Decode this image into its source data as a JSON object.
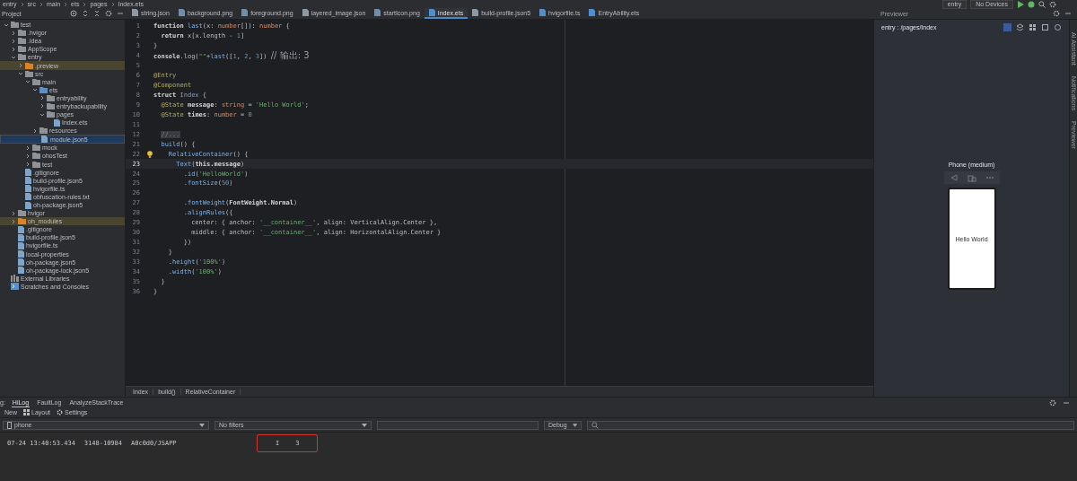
{
  "top_bar": {
    "breadcrumb": [
      "entry",
      "src",
      "main",
      "ets",
      "pages",
      "Index.ets"
    ],
    "run_config": "entry",
    "device": "No Devices"
  },
  "project_panel": {
    "title": "Project",
    "tree": [
      {
        "label": "test",
        "kind": "module",
        "expanded": true,
        "children": [
          {
            "label": ".hvigor",
            "kind": "folder",
            "expanded": false
          },
          {
            "label": ".idea",
            "kind": "folder",
            "expanded": false
          },
          {
            "label": "AppScope",
            "kind": "folder",
            "expanded": false
          },
          {
            "label": "entry",
            "kind": "module",
            "expanded": true,
            "children": [
              {
                "label": ".preview",
                "kind": "folder",
                "expanded": false,
                "excluded": true
              },
              {
                "label": "src",
                "kind": "folder",
                "expanded": true,
                "children": [
                  {
                    "label": "main",
                    "kind": "folder",
                    "expanded": true,
                    "children": [
                      {
                        "label": "ets",
                        "kind": "source",
                        "expanded": true,
                        "children": [
                          {
                            "label": "entryability",
                            "kind": "folder",
                            "expanded": false
                          },
                          {
                            "label": "entrybackupability",
                            "kind": "folder",
                            "expanded": false
                          },
                          {
                            "label": "pages",
                            "kind": "folder",
                            "expanded": true,
                            "children": [
                              {
                                "label": "Index.ets",
                                "kind": "file",
                                "selected": false
                              }
                            ]
                          }
                        ]
                      },
                      {
                        "label": "resources",
                        "kind": "folder",
                        "expanded": false
                      },
                      {
                        "label": "module.json5",
                        "kind": "file",
                        "selected": true
                      }
                    ]
                  },
                  {
                    "label": "mock",
                    "kind": "folder",
                    "expanded": false
                  },
                  {
                    "label": "ohosTest",
                    "kind": "folder",
                    "expanded": false
                  },
                  {
                    "label": "test",
                    "kind": "folder",
                    "expanded": false
                  }
                ]
              },
              {
                "label": ".gitignore",
                "kind": "file",
                "selected": false
              },
              {
                "label": "build-profile.json5",
                "kind": "file",
                "selected": false
              },
              {
                "label": "hvigorfile.ts",
                "kind": "file",
                "selected": false
              },
              {
                "label": "obfuscation-rules.txt",
                "kind": "file",
                "selected": false
              },
              {
                "label": "oh-package.json5",
                "kind": "file",
                "selected": false
              }
            ]
          },
          {
            "label": "hvigor",
            "kind": "folder",
            "expanded": false
          },
          {
            "label": "oh_modules",
            "kind": "folder",
            "expanded": false,
            "excluded": true
          },
          {
            "label": ".gitignore",
            "kind": "file",
            "selected": false
          },
          {
            "label": "build-profile.json5",
            "kind": "file",
            "selected": false
          },
          {
            "label": "hvigorfile.ts",
            "kind": "file",
            "selected": false
          },
          {
            "label": "local-properties",
            "kind": "file",
            "selected": false
          },
          {
            "label": "oh-package.json5",
            "kind": "file",
            "selected": false
          },
          {
            "label": "oh-package-lock.json5",
            "kind": "file",
            "selected": false
          }
        ]
      },
      {
        "label": "External Libraries",
        "kind": "library"
      },
      {
        "label": "Scratches and Consoles",
        "kind": "scratch"
      }
    ]
  },
  "editor_tabs": [
    {
      "label": "string.json",
      "kind": "json",
      "selected": false
    },
    {
      "label": "background.png",
      "kind": "image",
      "selected": false
    },
    {
      "label": "foreground.png",
      "kind": "image",
      "selected": false
    },
    {
      "label": "layered_image.json",
      "kind": "json",
      "selected": false
    },
    {
      "label": "startIcon.png",
      "kind": "image",
      "selected": false
    },
    {
      "label": "Index.ets",
      "kind": "code",
      "selected": true
    },
    {
      "label": "build-profile.json5",
      "kind": "json",
      "selected": false
    },
    {
      "label": "hvigorfile.ts",
      "kind": "code",
      "selected": false
    },
    {
      "label": "EntryAbility.ets",
      "kind": "code",
      "selected": false
    }
  ],
  "editor": {
    "lines": [
      {
        "number": "1",
        "tokens": [
          {
            "kind": "kw",
            "text": "function "
          },
          {
            "kind": "fn",
            "text": "last"
          },
          {
            "kind": "plain",
            "text": "(x: "
          },
          {
            "kind": "type",
            "text": "number"
          },
          {
            "kind": "plain",
            "text": "[]): "
          },
          {
            "kind": "type",
            "text": "number"
          },
          {
            "kind": "plain",
            "text": " {"
          }
        ]
      },
      {
        "number": "2",
        "tokens": [
          {
            "kind": "kw",
            "text": "  return "
          },
          {
            "kind": "plain",
            "text": "x[x.length - "
          },
          {
            "kind": "num",
            "text": "1"
          },
          {
            "kind": "plain",
            "text": "]"
          }
        ]
      },
      {
        "number": "3",
        "tokens": [
          {
            "kind": "plain",
            "text": "}"
          }
        ]
      },
      {
        "number": "4",
        "tokens": [
          {
            "kind": "kw",
            "text": "console"
          },
          {
            "kind": "plain",
            "text": ".log("
          },
          {
            "kind": "str",
            "text": "\"\""
          },
          {
            "kind": "plain",
            "text": "+"
          },
          {
            "kind": "fn",
            "text": "last"
          },
          {
            "kind": "plain",
            "text": "(["
          },
          {
            "kind": "num",
            "text": "1"
          },
          {
            "kind": "plain",
            "text": ", "
          },
          {
            "kind": "num",
            "text": "2"
          },
          {
            "kind": "plain",
            "text": ", "
          },
          {
            "kind": "num",
            "text": "3"
          },
          {
            "kind": "plain",
            "text": "]) "
          },
          {
            "kind": "cmt",
            "text": "// 输出: 3"
          }
        ]
      },
      {
        "number": "5"
      },
      {
        "number": "6",
        "tokens": [
          {
            "kind": "deco",
            "text": "@Entry"
          }
        ]
      },
      {
        "number": "7",
        "tokens": [
          {
            "kind": "deco",
            "text": "@Component"
          }
        ]
      },
      {
        "number": "8",
        "tokens": [
          {
            "kind": "kw",
            "text": "struct "
          },
          {
            "kind": "cls",
            "text": "Index"
          },
          {
            "kind": "plain",
            "text": " {"
          }
        ]
      },
      {
        "number": "9",
        "tokens": [
          {
            "kind": "deco",
            "text": "  @State "
          },
          {
            "kind": "kw",
            "text": "message"
          },
          {
            "kind": "plain",
            "text": ": "
          },
          {
            "kind": "type",
            "text": "string"
          },
          {
            "kind": "plain",
            "text": " = "
          },
          {
            "kind": "str",
            "text": "'Hello World'"
          },
          {
            "kind": "plain",
            "text": ";"
          }
        ]
      },
      {
        "number": "10",
        "tokens": [
          {
            "kind": "deco",
            "text": "  @State "
          },
          {
            "kind": "kw",
            "text": "times"
          },
          {
            "kind": "plain",
            "text": ": "
          },
          {
            "kind": "type",
            "text": "number"
          },
          {
            "kind": "plain",
            "text": " = "
          },
          {
            "kind": "num",
            "text": "0"
          }
        ]
      },
      {
        "number": "11"
      },
      {
        "number": "12",
        "tokens": [
          {
            "kind": "fold",
            "text": "  //..."
          }
        ]
      },
      {
        "number": "21",
        "tokens": [
          {
            "kind": "fn",
            "text": "  build"
          },
          {
            "kind": "plain",
            "text": "() {"
          }
        ]
      },
      {
        "number": "22",
        "hint": true,
        "tokens": [
          {
            "kind": "fn",
            "text": "    RelativeContainer"
          },
          {
            "kind": "plain",
            "text": "() {"
          }
        ]
      },
      {
        "number": "23",
        "current": true,
        "tokens": [
          {
            "kind": "fn",
            "text": "      Text"
          },
          {
            "kind": "plain",
            "text": "("
          },
          {
            "kind": "kw",
            "text": "this.message"
          },
          {
            "kind": "plain",
            "text": ")"
          }
        ]
      },
      {
        "number": "24",
        "tokens": [
          {
            "kind": "plain",
            "text": "        ."
          },
          {
            "kind": "fn",
            "text": "id"
          },
          {
            "kind": "plain",
            "text": "("
          },
          {
            "kind": "str",
            "text": "'HelloWorld'"
          },
          {
            "kind": "plain",
            "text": ")"
          }
        ]
      },
      {
        "number": "25",
        "tokens": [
          {
            "kind": "plain",
            "text": "        ."
          },
          {
            "kind": "fn",
            "text": "fontSize"
          },
          {
            "kind": "plain",
            "text": "("
          },
          {
            "kind": "num",
            "text": "50"
          },
          {
            "kind": "plain",
            "text": ")"
          }
        ]
      },
      {
        "number": "26"
      },
      {
        "number": "27",
        "tokens": [
          {
            "kind": "plain",
            "text": "        ."
          },
          {
            "kind": "fn",
            "text": "fontWeight"
          },
          {
            "kind": "plain",
            "text": "("
          },
          {
            "kind": "kw",
            "text": "FontWeight.Normal"
          },
          {
            "kind": "plain",
            "text": ")"
          }
        ]
      },
      {
        "number": "28",
        "tokens": [
          {
            "kind": "plain",
            "text": "        ."
          },
          {
            "kind": "fn",
            "text": "alignRules"
          },
          {
            "kind": "plain",
            "text": "({"
          }
        ]
      },
      {
        "number": "29",
        "tokens": [
          {
            "kind": "plain",
            "text": "          center: { anchor: "
          },
          {
            "kind": "str",
            "text": "'__container__'"
          },
          {
            "kind": "plain",
            "text": ", align: VerticalAlign.Center },"
          }
        ]
      },
      {
        "number": "30",
        "tokens": [
          {
            "kind": "plain",
            "text": "          middle: { anchor: "
          },
          {
            "kind": "str",
            "text": "'__container__'"
          },
          {
            "kind": "plain",
            "text": ", align: HorizontalAlign.Center }"
          }
        ]
      },
      {
        "number": "31",
        "tokens": [
          {
            "kind": "plain",
            "text": "        })"
          }
        ]
      },
      {
        "number": "32",
        "tokens": [
          {
            "kind": "plain",
            "text": "    }"
          }
        ]
      },
      {
        "number": "33",
        "tokens": [
          {
            "kind": "plain",
            "text": "    ."
          },
          {
            "kind": "fn",
            "text": "height"
          },
          {
            "kind": "plain",
            "text": "("
          },
          {
            "kind": "str",
            "text": "'100%'"
          },
          {
            "kind": "plain",
            "text": ")"
          }
        ]
      },
      {
        "number": "34",
        "tokens": [
          {
            "kind": "plain",
            "text": "    ."
          },
          {
            "kind": "fn",
            "text": "width"
          },
          {
            "kind": "plain",
            "text": "("
          },
          {
            "kind": "str",
            "text": "'100%'"
          },
          {
            "kind": "plain",
            "text": ")"
          }
        ]
      },
      {
        "number": "35",
        "tokens": [
          {
            "kind": "plain",
            "text": "  }"
          }
        ]
      },
      {
        "number": "36",
        "tokens": [
          {
            "kind": "plain",
            "text": "}"
          }
        ]
      }
    ],
    "breadcrumb": [
      "Index",
      "build()",
      "RelativeContainer"
    ]
  },
  "previewer": {
    "title": "Previewer",
    "path": "entry : /pages/Index",
    "device_name": "Phone (medium)",
    "screen_text": "Hello World"
  },
  "side_strip": [
    "AI Assistant",
    "Notifications",
    "Previewer"
  ],
  "log_panel": {
    "title": "g:",
    "tabs": [
      {
        "label": "HiLog",
        "selected": true
      },
      {
        "label": "FaultLog",
        "selected": false
      },
      {
        "label": "AnalyzeStackTrace",
        "selected": false
      }
    ],
    "toolbar": [
      "New",
      "Layout",
      "Settings"
    ],
    "device": "phone",
    "filter": "No filters",
    "level": "Debug",
    "entries": [
      {
        "time": "07-24 13:40:53.434",
        "pid": "3148-10984",
        "tag": "A0c0d0/JSAPP",
        "level": "I",
        "message": "3",
        "marked": true
      }
    ]
  }
}
